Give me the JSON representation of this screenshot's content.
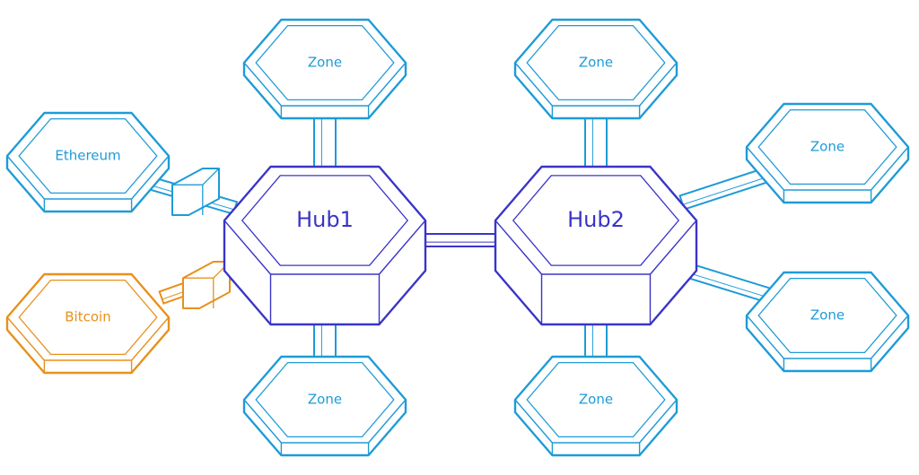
{
  "colors": {
    "zone": "#1e9bd7",
    "hub": "#3a34c8",
    "bitcoin": "#e8901c",
    "fill": "#ffffff"
  },
  "hubs": [
    {
      "id": "hub1",
      "label": "Hub1"
    },
    {
      "id": "hub2",
      "label": "Hub2"
    }
  ],
  "zones": [
    {
      "id": "zone-hub1-top",
      "label": "Zone",
      "hub": "hub1",
      "kind": "zone"
    },
    {
      "id": "zone-hub1-bottom",
      "label": "Zone",
      "hub": "hub1",
      "kind": "zone"
    },
    {
      "id": "ethereum",
      "label": "Ethereum",
      "hub": "hub1",
      "kind": "zone",
      "via_peg": true
    },
    {
      "id": "bitcoin",
      "label": "Bitcoin",
      "hub": "hub1",
      "kind": "bitcoin",
      "via_peg": true
    },
    {
      "id": "zone-hub2-top",
      "label": "Zone",
      "hub": "hub2",
      "kind": "zone"
    },
    {
      "id": "zone-hub2-bottom",
      "label": "Zone",
      "hub": "hub2",
      "kind": "zone"
    },
    {
      "id": "zone-hub2-right-top",
      "label": "Zone",
      "hub": "hub2",
      "kind": "zone"
    },
    {
      "id": "zone-hub2-right-bottom",
      "label": "Zone",
      "hub": "hub2",
      "kind": "zone"
    }
  ],
  "links": [
    {
      "from": "hub1",
      "to": "hub2"
    }
  ]
}
